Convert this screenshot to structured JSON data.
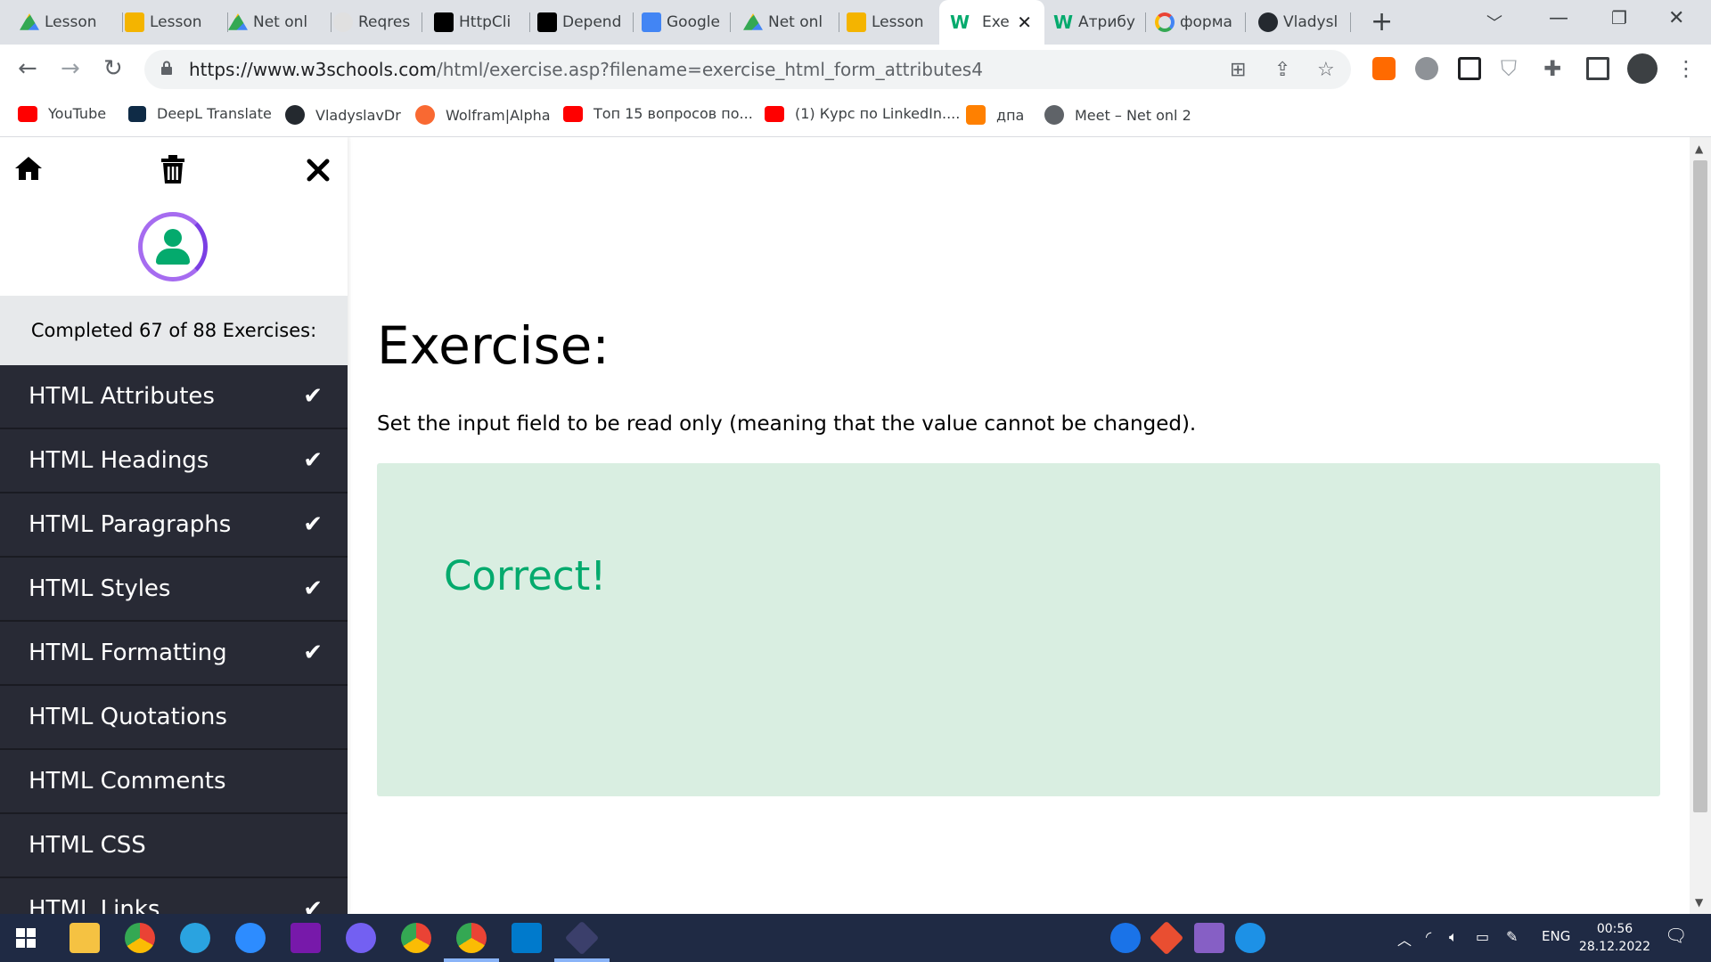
{
  "browser": {
    "tabs": [
      {
        "title": "Lesson",
        "icon": "google-drive-icon",
        "color": "#34a853"
      },
      {
        "title": "Lesson",
        "icon": "google-slides-icon",
        "color": "#f4b400"
      },
      {
        "title": "Net onl",
        "icon": "google-drive-icon",
        "color": "#34a853"
      },
      {
        "title": "Reqres",
        "icon": "reqres-icon",
        "color": "#9aa0a6"
      },
      {
        "title": "HttpCli",
        "icon": "medium-icon",
        "color": "#000000"
      },
      {
        "title": "Depend",
        "icon": "medium-icon",
        "color": "#000000"
      },
      {
        "title": "Google",
        "icon": "google-calendar-icon",
        "color": "#4285f4"
      },
      {
        "title": "Net onl",
        "icon": "google-drive-icon",
        "color": "#34a853"
      },
      {
        "title": "Lesson",
        "icon": "google-slides-icon",
        "color": "#f4b400"
      },
      {
        "title": "Exe",
        "icon": "w3schools-icon",
        "color": "#04aa6d",
        "active": true
      },
      {
        "title": "Атрибу",
        "icon": "w3schools-icon",
        "color": "#04aa6d"
      },
      {
        "title": "форма",
        "icon": "google-icon",
        "color": "#4285f4"
      },
      {
        "title": "Vladysl",
        "icon": "github-icon",
        "color": "#24292f"
      }
    ],
    "new_tab_label": "+",
    "url_host": "https://www.w3schools.com",
    "url_rest": "/html/exercise.asp?filename=exercise_html_form_attributes4",
    "bookmarks": [
      {
        "label": "YouTube",
        "icon": "youtube-icon",
        "color": "#ff0000"
      },
      {
        "label": "DeepL Translate",
        "icon": "deepl-icon",
        "color": "#0f2b46"
      },
      {
        "label": "VladyslavDr",
        "icon": "github-icon",
        "color": "#24292f"
      },
      {
        "label": "Wolfram|Alpha",
        "icon": "wolfram-icon",
        "color": "#f96932"
      },
      {
        "label": "Топ 15 вопросов по...",
        "icon": "youtube-icon",
        "color": "#ff0000"
      },
      {
        "label": "(1) Курс по LinkedIn....",
        "icon": "youtube-icon",
        "color": "#ff0000"
      },
      {
        "label": "дпа",
        "icon": "blogger-icon",
        "color": "#ff8000"
      },
      {
        "label": "Meet – Net onl 2",
        "icon": "globe-icon",
        "color": "#5f6368"
      }
    ]
  },
  "sidebar": {
    "progress_text": "Completed 67 of 88 Exercises:",
    "items": [
      {
        "label": "HTML Attributes",
        "done": true
      },
      {
        "label": "HTML Headings",
        "done": true
      },
      {
        "label": "HTML Paragraphs",
        "done": true
      },
      {
        "label": "HTML Styles",
        "done": true
      },
      {
        "label": "HTML Formatting",
        "done": true
      },
      {
        "label": "HTML Quotations",
        "done": false
      },
      {
        "label": "HTML Comments",
        "done": false
      },
      {
        "label": "HTML CSS",
        "done": false
      },
      {
        "label": "HTML Links",
        "done": true
      }
    ],
    "check_glyph": "✔"
  },
  "main": {
    "title": "Exercise:",
    "description": "Set the input field to be read only (meaning that the value cannot be changed).",
    "result": "Correct!"
  },
  "taskbar": {
    "language": "ENG",
    "time": "00:56",
    "date": "28.12.2022"
  },
  "colors": {
    "sidebar_bg": "#282a35",
    "accent_green": "#04aa6d",
    "result_bg": "#d9eee1"
  }
}
